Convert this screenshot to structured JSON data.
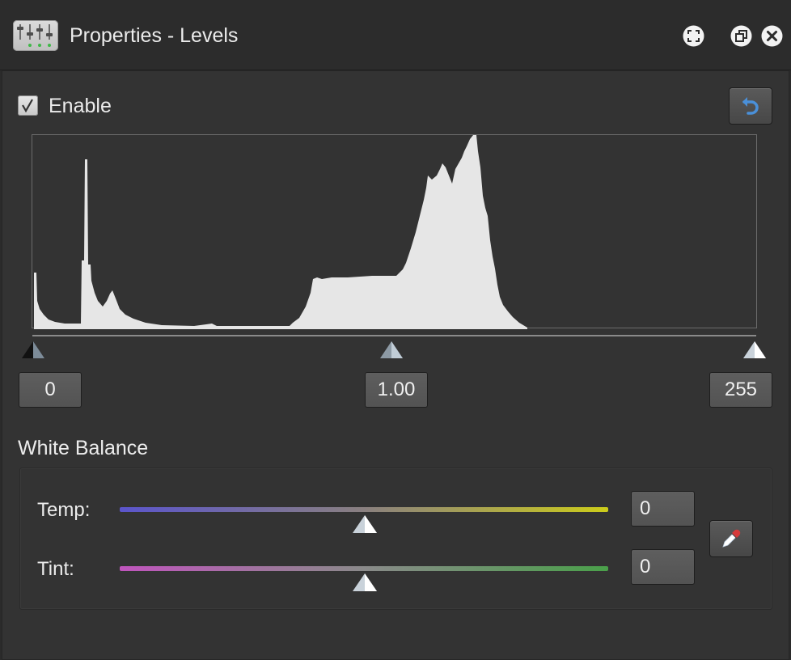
{
  "window": {
    "title": "Properties - Levels",
    "app_icon": "levels-sliders-icon",
    "buttons": [
      "fullscreen-icon",
      "popout-icon",
      "close-icon"
    ]
  },
  "enable": {
    "label": "Enable",
    "checked": true
  },
  "levels": {
    "black_point": "0",
    "gamma": "1.00",
    "white_point": "255",
    "black_point_value": 0,
    "gamma_value": 1.0,
    "white_point_value": 255
  },
  "white_balance": {
    "title": "White Balance",
    "temp": {
      "label": "Temp:",
      "value": "0"
    },
    "tint": {
      "label": "Tint:",
      "value": "0"
    }
  },
  "colors": {
    "background": "#333333",
    "histogram_fill": "#e6e6e6",
    "accent_blue": "#4a90d9",
    "temp_start": "#5b55cc",
    "temp_end": "#cccc1a",
    "tint_start": "#c055bd",
    "tint_end": "#4aa04a"
  }
}
